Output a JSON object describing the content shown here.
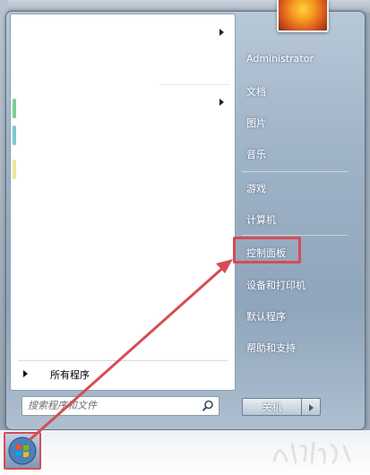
{
  "user": {
    "name": "Administrator"
  },
  "right_menu": {
    "documents": "文档",
    "pictures": "图片",
    "music": "音乐",
    "games": "游戏",
    "computer": "计算机",
    "control_panel": "控制面板",
    "devices_printers": "设备和打印机",
    "default_programs": "默认程序",
    "help_support": "帮助和支持"
  },
  "left_menu": {
    "all_programs": "所有程序"
  },
  "search": {
    "placeholder": "搜索程序和文件"
  },
  "shutdown": {
    "label": "关机"
  },
  "icons": {
    "search": "search-icon",
    "start": "windows-logo-icon",
    "submenu": "chevron-right-icon",
    "shutdown_options": "chevron-right-icon"
  },
  "colors": {
    "highlight": "#d74c54",
    "annotation_arrow": "#d74c54"
  }
}
